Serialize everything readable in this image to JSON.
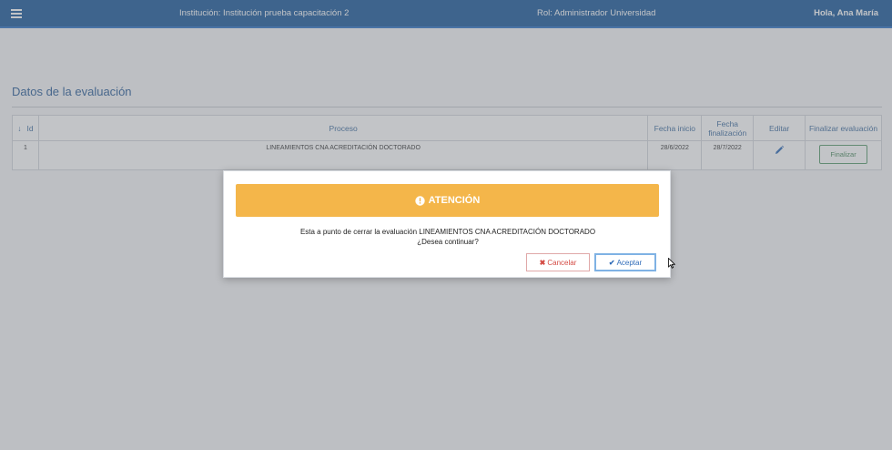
{
  "header": {
    "institution": "Institución: Institución prueba capacitación 2",
    "role": "Rol: Administrador Universidad",
    "greeting": "Hola, Ana María"
  },
  "page": {
    "title": "Datos de la evaluación"
  },
  "table": {
    "columns": [
      "Id",
      "Proceso",
      "Fecha inicio",
      "Fecha finalización",
      "Editar",
      "Finalizar evaluación"
    ],
    "rows": [
      {
        "id": "1",
        "proceso": "LINEAMIENTOS CNA ACREDITACIÓN DOCTORADO",
        "fecha_inicio": "28/6/2022",
        "fecha_fin": "28/7/2022",
        "finalizar_label": "Finalizar"
      }
    ]
  },
  "dialog": {
    "title": "ATENCIÓN",
    "message_line1": "Esta a punto de cerrar la evaluación LINEAMIENTOS CNA ACREDITACIÓN DOCTORADO",
    "message_line2": "¿Desea continuar?",
    "cancel_label": "Cancelar",
    "accept_label": "Aceptar"
  },
  "colors": {
    "header_bg": "#1d5a9c",
    "warning": "#f4b64a",
    "cancel": "#d44b44",
    "accept": "#2f6bb8",
    "finalizar": "#4a8a5e"
  }
}
